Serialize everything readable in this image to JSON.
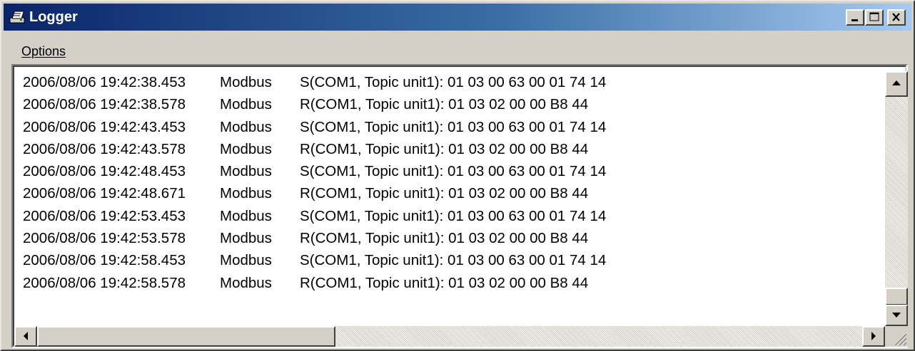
{
  "window": {
    "title": "Logger",
    "icon": "logger-app-icon",
    "controls": [
      "minimize",
      "maximize",
      "close"
    ]
  },
  "menu": {
    "items": [
      {
        "label": "Options"
      }
    ]
  },
  "log": {
    "rows": [
      {
        "timestamp": "2006/08/06 19:42:38.453",
        "source": "Modbus",
        "message": "S(COM1, Topic unit1): 01 03 00 63 00 01 74 14"
      },
      {
        "timestamp": "2006/08/06 19:42:38.578",
        "source": "Modbus",
        "message": "R(COM1, Topic unit1): 01 03 02 00 00 B8 44"
      },
      {
        "timestamp": "2006/08/06 19:42:43.453",
        "source": "Modbus",
        "message": "S(COM1, Topic unit1): 01 03 00 63 00 01 74 14"
      },
      {
        "timestamp": "2006/08/06 19:42:43.578",
        "source": "Modbus",
        "message": "R(COM1, Topic unit1): 01 03 02 00 00 B8 44"
      },
      {
        "timestamp": "2006/08/06 19:42:48.453",
        "source": "Modbus",
        "message": "S(COM1, Topic unit1): 01 03 00 63 00 01 74 14"
      },
      {
        "timestamp": "2006/08/06 19:42:48.671",
        "source": "Modbus",
        "message": "R(COM1, Topic unit1): 01 03 02 00 00 B8 44"
      },
      {
        "timestamp": "2006/08/06 19:42:53.453",
        "source": "Modbus",
        "message": "S(COM1, Topic unit1): 01 03 00 63 00 01 74 14"
      },
      {
        "timestamp": "2006/08/06 19:42:53.578",
        "source": "Modbus",
        "message": "R(COM1, Topic unit1): 01 03 02 00 00 B8 44"
      },
      {
        "timestamp": "2006/08/06 19:42:58.453",
        "source": "Modbus",
        "message": "S(COM1, Topic unit1): 01 03 00 63 00 01 74 14"
      },
      {
        "timestamp": "2006/08/06 19:42:58.578",
        "source": "Modbus",
        "message": "R(COM1, Topic unit1): 01 03 02 00 00 B8 44"
      }
    ]
  },
  "scrollbars": {
    "vertical_icons": [
      "arrow-up-icon",
      "arrow-down-icon"
    ],
    "horizontal_icons": [
      "arrow-left-icon",
      "arrow-right-icon"
    ]
  },
  "colors": {
    "titlebar_start": "#0a246a",
    "titlebar_end": "#a6caf0",
    "window_face": "#d4d0c8",
    "log_background": "#ffffff",
    "text": "#000000"
  }
}
